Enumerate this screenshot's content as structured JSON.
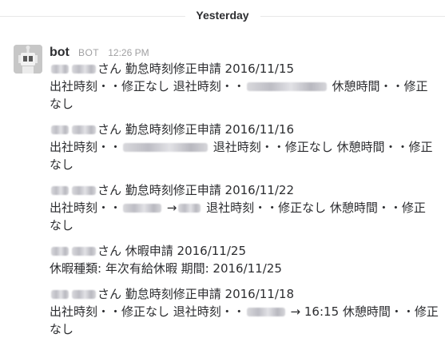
{
  "divider": {
    "label": "Yesterday"
  },
  "message_group": {
    "sender": "bot",
    "badge": "BOT",
    "time": "12:26 PM",
    "messages": [
      {
        "title_suffix": "さん 勤怠時刻修正申請 2016/11/15",
        "body_a": "出社時刻・・修正なし 退社時刻・・",
        "body_b": " 休憩時間・・修正",
        "body_c": "なし"
      },
      {
        "title_suffix": "さん 勤怠時刻修正申請 2016/11/16",
        "body_a": "出社時刻・・",
        "body_b": " 退社時刻・・修正なし 休憩時間・・修正",
        "body_c": "なし"
      },
      {
        "title_suffix": "さん 勤怠時刻修正申請 2016/11/22",
        "body_a": "出社時刻・・",
        "body_b": " →",
        "body_c": " 退社時刻・・修正なし 休憩時間・・修正",
        "body_d": "なし"
      },
      {
        "title_suffix": "さん 休暇申請 2016/11/25",
        "body_a": "休暇種類: 年次有給休暇 期間: 2016/11/25"
      },
      {
        "title_suffix": "さん 勤怠時刻修正申請 2016/11/18",
        "body_a": "出社時刻・・修正なし 退社時刻・・",
        "body_b": " → 16:15 休憩時間・・修正",
        "body_c": "なし"
      }
    ]
  }
}
